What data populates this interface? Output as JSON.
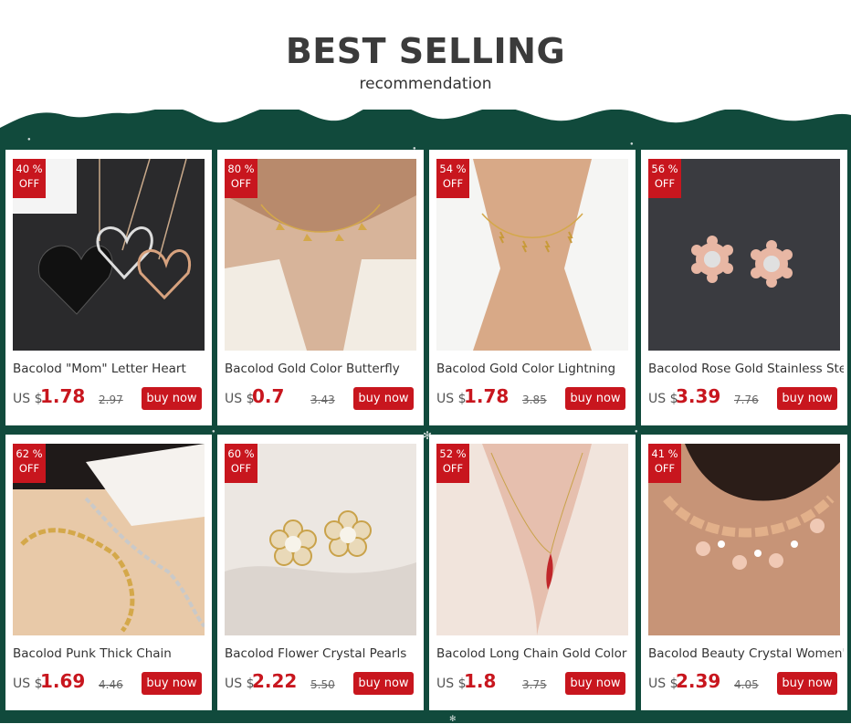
{
  "header": {
    "title": "BEST SELLING",
    "subtitle": "recommendation"
  },
  "colors": {
    "background": "#114a3c",
    "accent": "#c8161e"
  },
  "products": [
    {
      "discount_value": "40 %",
      "discount_label": "OFF",
      "name": "Bacolod \"Mom\" Letter Heart",
      "currency": "US $",
      "price": "1.78",
      "old_price": "2.97",
      "buy_label": "buy now"
    },
    {
      "discount_value": "80 %",
      "discount_label": "OFF",
      "name": "Bacolod Gold Color Butterfly",
      "currency": "US $",
      "price": "0.7",
      "old_price": "3.43",
      "buy_label": "buy now"
    },
    {
      "discount_value": "54 %",
      "discount_label": "OFF",
      "name": "Bacolod Gold Color Lightning",
      "currency": "US $",
      "price": "1.78",
      "old_price": "3.85",
      "buy_label": "buy now"
    },
    {
      "discount_value": "56 %",
      "discount_label": "OFF",
      "name": "Bacolod Rose Gold Stainless Steel",
      "currency": "US $",
      "price": "3.39",
      "old_price": "7.76",
      "buy_label": "buy now"
    },
    {
      "discount_value": "62 %",
      "discount_label": "OFF",
      "name": "Bacolod Punk Thick Chain",
      "currency": "US $",
      "price": "1.69",
      "old_price": "4.46",
      "buy_label": "buy now"
    },
    {
      "discount_value": "60 %",
      "discount_label": "OFF",
      "name": "Bacolod Flower Crystal Pearls",
      "currency": "US $",
      "price": "2.22",
      "old_price": "5.50",
      "buy_label": "buy now"
    },
    {
      "discount_value": "52 %",
      "discount_label": "OFF",
      "name": "Bacolod Long Chain Gold Color",
      "currency": "US $",
      "price": "1.8",
      "old_price": "3.75",
      "buy_label": "buy now"
    },
    {
      "discount_value": "41 %",
      "discount_label": "OFF",
      "name": "Bacolod Beauty Crystal Women's",
      "currency": "US $",
      "price": "2.39",
      "old_price": "4.05",
      "buy_label": "buy now"
    }
  ]
}
